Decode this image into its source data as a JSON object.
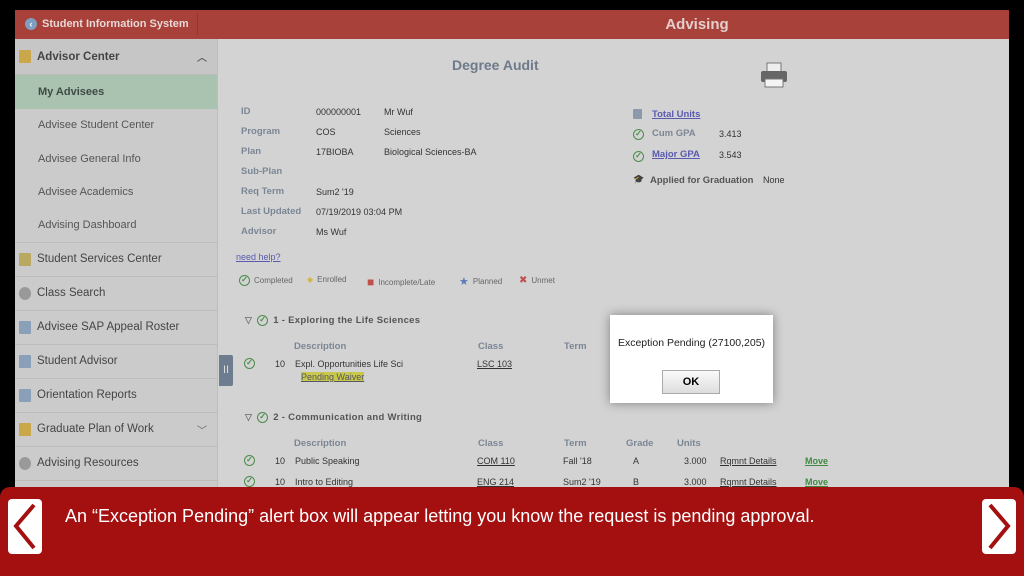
{
  "header": {
    "back_label": "Student Information System",
    "title": "Advising"
  },
  "sidebar": {
    "items": [
      {
        "label": "Advisor Center",
        "type": "header",
        "expanded": true,
        "icon": "book-icon"
      },
      {
        "label": "My Advisees",
        "type": "sub",
        "selected": true
      },
      {
        "label": "Advisee Student Center",
        "type": "sub"
      },
      {
        "label": "Advisee General Info",
        "type": "sub"
      },
      {
        "label": "Advisee Academics",
        "type": "sub"
      },
      {
        "label": "Advising Dashboard",
        "type": "sub"
      },
      {
        "label": "Student Services Center",
        "type": "top",
        "icon": "person-icon"
      },
      {
        "label": "Class Search",
        "type": "top",
        "icon": "globe-icon"
      },
      {
        "label": "Advisee SAP Appeal Roster",
        "type": "top",
        "icon": "window-icon"
      },
      {
        "label": "Student Advisor",
        "type": "top",
        "icon": "window-icon"
      },
      {
        "label": "Orientation Reports",
        "type": "top",
        "icon": "window-icon"
      },
      {
        "label": "Graduate Plan of Work",
        "type": "top",
        "icon": "book-icon",
        "chevron": true
      },
      {
        "label": "Advising Resources",
        "type": "top",
        "icon": "globe-icon"
      }
    ]
  },
  "audit": {
    "title": "Degree Audit",
    "fields": [
      {
        "label": "ID",
        "v1": "000000001",
        "v2": "Mr Wuf"
      },
      {
        "label": "Program",
        "v1": "COS",
        "v2": "Sciences"
      },
      {
        "label": "Plan",
        "v1": "17BIOBA",
        "v2": "Biological Sciences-BA"
      },
      {
        "label": "Sub-Plan",
        "v1": "",
        "v2": ""
      },
      {
        "label": "Req Term",
        "v1": "Sum2 '19",
        "v2": ""
      },
      {
        "label": "Last Updated",
        "v1": "07/19/2019 03:04 PM",
        "v2": ""
      },
      {
        "label": "Advisor",
        "v1": "Ms Wuf",
        "v2": ""
      }
    ],
    "summary": {
      "total_units": "Total Units",
      "cum_gpa_label": "Cum GPA",
      "cum_gpa": "3.413",
      "major_gpa_label": "Major GPA",
      "major_gpa": "3.543",
      "grad_label": "Applied for Graduation",
      "grad_value": "None"
    },
    "need_help": "need help?",
    "legend": [
      "Completed",
      "Enrolled",
      "Incomplete/Late",
      "Planned",
      "Unmet"
    ],
    "groups": [
      {
        "title": "1 - Exploring the Life Sciences",
        "headers": [
          "Description",
          "Class",
          "Term"
        ],
        "rows": [
          {
            "num": "10",
            "desc": "Expl. Opportunities Life Sci",
            "class": "LSC 103",
            "note": "Pending Waiver"
          }
        ]
      },
      {
        "title": "2 - Communication and Writing",
        "headers": [
          "Description",
          "Class",
          "Term",
          "Grade",
          "Units"
        ],
        "rows": [
          {
            "num": "10",
            "desc": "Public Speaking",
            "class": "COM 110",
            "term": "Fall '18",
            "grade": "A",
            "units": "3.000",
            "details": "Rqmnt Details",
            "move": "Move"
          },
          {
            "num": "10",
            "desc": "Intro to Editing",
            "class": "ENG 214",
            "term": "Sum2 '19",
            "grade": "B",
            "units": "3.000",
            "details": "Rqmnt Details",
            "move": "Move"
          }
        ]
      }
    ]
  },
  "dialog": {
    "message": "Exception Pending (27100,205)",
    "ok_label": "OK"
  },
  "caption": {
    "text": "An “Exception Pending” alert box will appear letting you know the request is pending approval."
  },
  "colors": {
    "header": "#a8413a",
    "caption": "#a40f0f",
    "selected": "#a9c3b0"
  }
}
